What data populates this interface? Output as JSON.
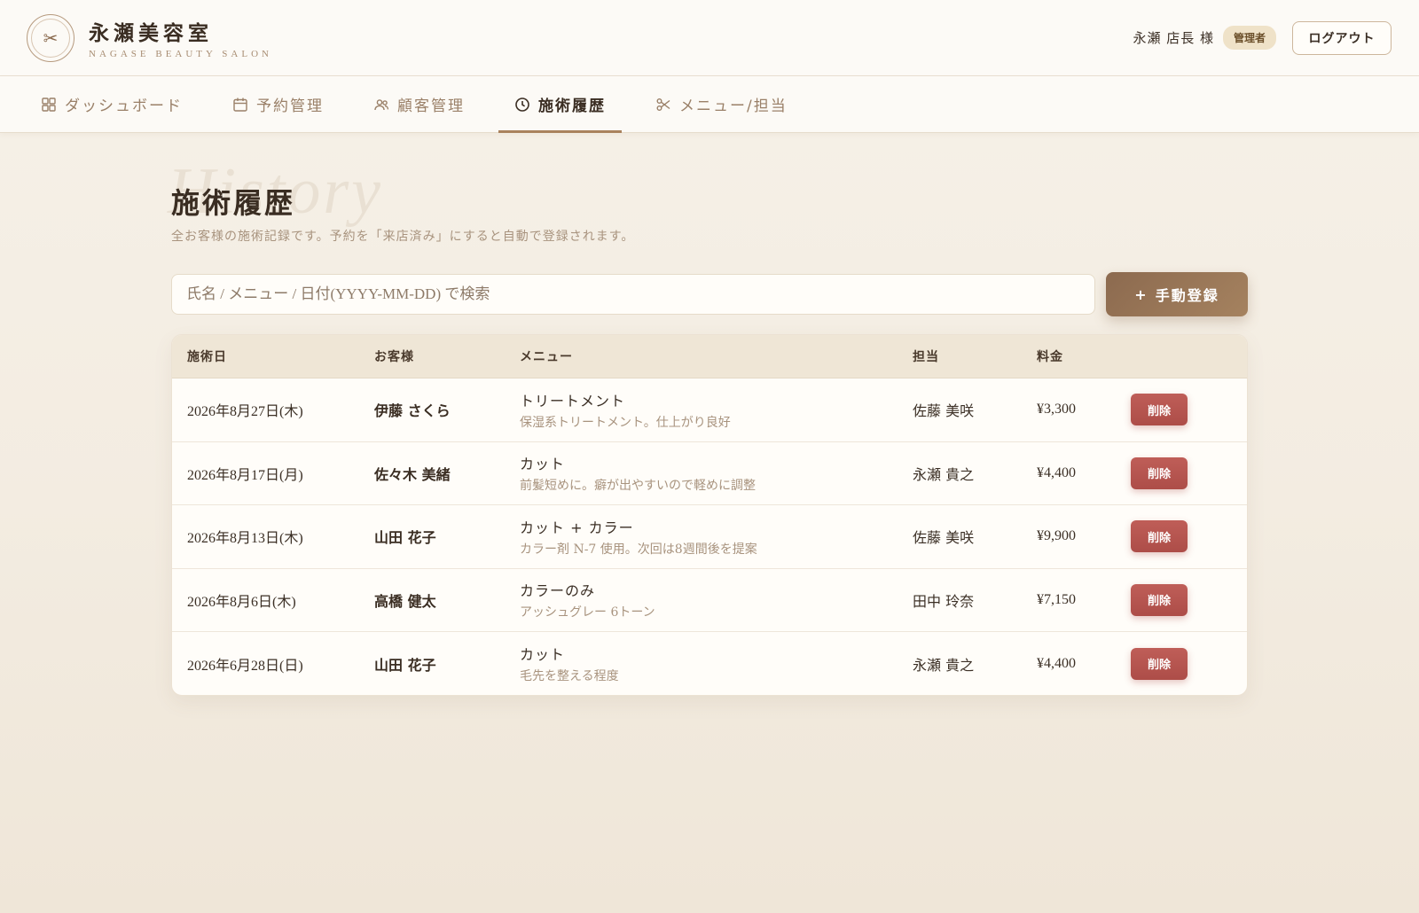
{
  "brand": {
    "name": "永瀬美容室",
    "subtitle": "NAGASE BEAUTY SALON",
    "logo_icon": "✂"
  },
  "user": {
    "name": "永瀬 店長 様",
    "role_badge": "管理者",
    "logout_label": "ログアウト"
  },
  "nav": {
    "items": [
      {
        "label": "ダッシュボード",
        "icon": "dashboard-icon"
      },
      {
        "label": "予約管理",
        "icon": "calendar-icon"
      },
      {
        "label": "顧客管理",
        "icon": "users-icon"
      },
      {
        "label": "施術履歴",
        "icon": "clock-icon",
        "active": true
      },
      {
        "label": "メニュー/担当",
        "icon": "scissors-icon"
      }
    ]
  },
  "page": {
    "background_word": "History",
    "title": "施術履歴",
    "description": "全お客様の施術記録です。予約を「来店済み」にすると自動で登録されます。"
  },
  "search": {
    "placeholder": "氏名 / メニュー / 日付(YYYY-MM-DD) で検索",
    "value": ""
  },
  "add_button": {
    "icon": "+",
    "label": "手動登録"
  },
  "table": {
    "headers": [
      "施術日",
      "お客様",
      "メニュー",
      "担当",
      "料金",
      ""
    ],
    "rows": [
      {
        "date": "2026年8月27日(木)",
        "customer": "伊藤 さくら",
        "menu": "トリートメント",
        "note": "保湿系トリートメント。仕上がり良好",
        "staff": "佐藤 美咲",
        "price": "¥3,300",
        "action": "削除"
      },
      {
        "date": "2026年8月17日(月)",
        "customer": "佐々木 美緒",
        "menu": "カット",
        "note": "前髪短めに。癖が出やすいので軽めに調整",
        "staff": "永瀬 貴之",
        "price": "¥4,400",
        "action": "削除"
      },
      {
        "date": "2026年8月13日(木)",
        "customer": "山田 花子",
        "menu": "カット + カラー",
        "note": "カラー剤 N-7 使用。次回は8週間後を提案",
        "staff": "佐藤 美咲",
        "price": "¥9,900",
        "action": "削除"
      },
      {
        "date": "2026年8月6日(木)",
        "customer": "高橋 健太",
        "menu": "カラーのみ",
        "note": "アッシュグレー 6トーン",
        "staff": "田中 玲奈",
        "price": "¥7,150",
        "action": "削除"
      },
      {
        "date": "2026年6月28日(日)",
        "customer": "山田 花子",
        "menu": "カット",
        "note": "毛先を整える程度",
        "staff": "永瀬 貴之",
        "price": "¥4,400",
        "action": "削除"
      }
    ]
  },
  "colors": {
    "accent": "#a9825d",
    "primary_button": "#8c6a4f",
    "delete_button": "#b85551",
    "badge_bg": "#efe2c8"
  }
}
